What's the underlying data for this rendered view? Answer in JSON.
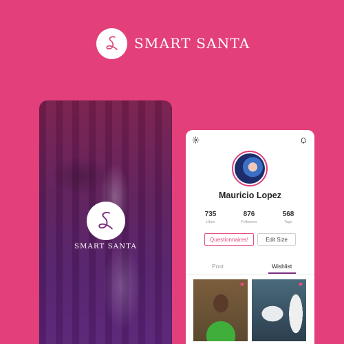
{
  "brand": {
    "name": "SMART SANTA",
    "logo_icon": "script-s-logo-icon"
  },
  "splash": {
    "brand_text": "SMART SANTA"
  },
  "profile": {
    "name": "Mauricio Lopez",
    "stats": [
      {
        "value": "735",
        "label": "Likes"
      },
      {
        "value": "876",
        "label": "Followers"
      },
      {
        "value": "568",
        "label": "Tags"
      }
    ],
    "buttons": {
      "questionnaires": "Questionnaires!",
      "edit_size": "Edit Size"
    },
    "tabs": [
      {
        "label": "Post",
        "active": false
      },
      {
        "label": "Wishlist",
        "active": true
      }
    ],
    "icons": {
      "settings": "gear-icon",
      "notifications": "bell-icon",
      "favorite": "heart-icon"
    }
  },
  "colors": {
    "background": "#e33f7a",
    "accent": "#e54c83",
    "tab_underline": "#7b2a80"
  }
}
